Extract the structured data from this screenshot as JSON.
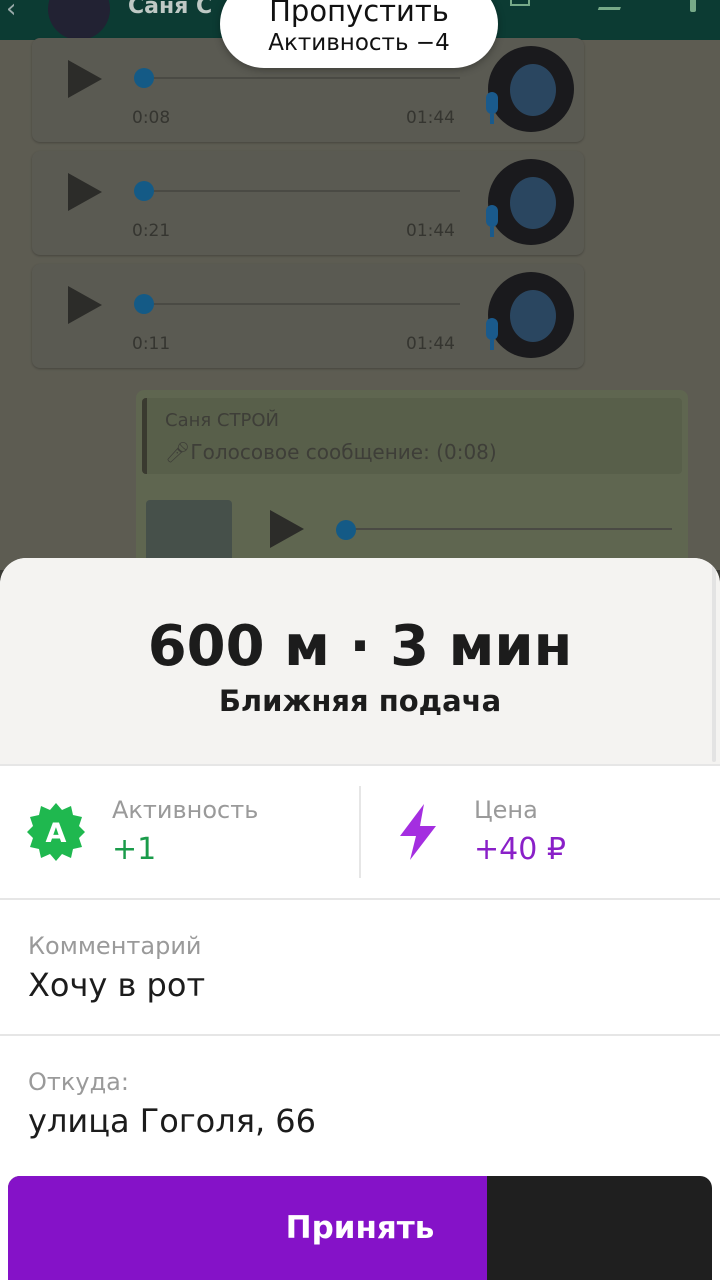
{
  "chat": {
    "header_title": "Саня С",
    "voice_messages": [
      {
        "position": "0:08",
        "duration": "01:44"
      },
      {
        "position": "0:21",
        "duration": "01:44"
      },
      {
        "position": "0:11",
        "duration": "01:44"
      }
    ],
    "reply": {
      "quoted_name": "Саня СТРОЙ",
      "quoted_text": "Голосовое сообщение: (0:08)"
    }
  },
  "skip": {
    "title": "Пропустить",
    "subtitle": "Активность −4"
  },
  "order": {
    "distance_time": "600 м · 3 мин",
    "pickup_type": "Ближняя подача",
    "activity": {
      "label": "Активность",
      "value": "+1",
      "badge": "A",
      "color": "#1a9b4a"
    },
    "price": {
      "label": "Цена",
      "value": "+40 ₽",
      "icon": "lightning-icon",
      "color": "#8a20c8"
    },
    "comment": {
      "label": "Комментарий",
      "value": "Хочу в рот"
    },
    "from": {
      "label": "Откуда:",
      "value": "улица Гоголя, 66"
    }
  },
  "accept": {
    "label": "Принять",
    "accent": "#8512c8",
    "progress": 0.68
  }
}
